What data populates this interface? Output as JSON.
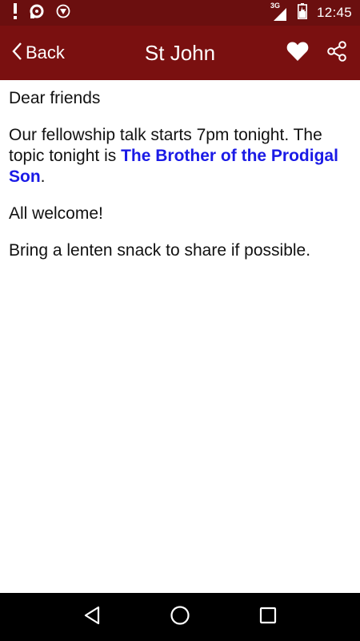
{
  "status_bar": {
    "time": "12:45",
    "network_label": "3G",
    "icons": [
      "alert-icon",
      "sync-icon",
      "shield-icon",
      "signal-icon",
      "battery-icon"
    ]
  },
  "app_bar": {
    "back_label": "Back",
    "title": "St John",
    "icons": [
      "chevron-left-icon",
      "heart-icon",
      "share-icon"
    ],
    "background": "#7a1010"
  },
  "message": {
    "greeting": "Dear friends",
    "body_prefix": "Our fellowship talk starts 7pm tonight. The topic tonight is ",
    "topic_link": "The Brother of the Prodigal Son",
    "body_suffix": ".",
    "welcome": "All welcome!",
    "closing": "Bring a lenten snack to share if possible.",
    "link_color": "#1a1ae6"
  },
  "nav_bar": {
    "icons": [
      "back-triangle-icon",
      "home-circle-icon",
      "recents-square-icon"
    ]
  }
}
